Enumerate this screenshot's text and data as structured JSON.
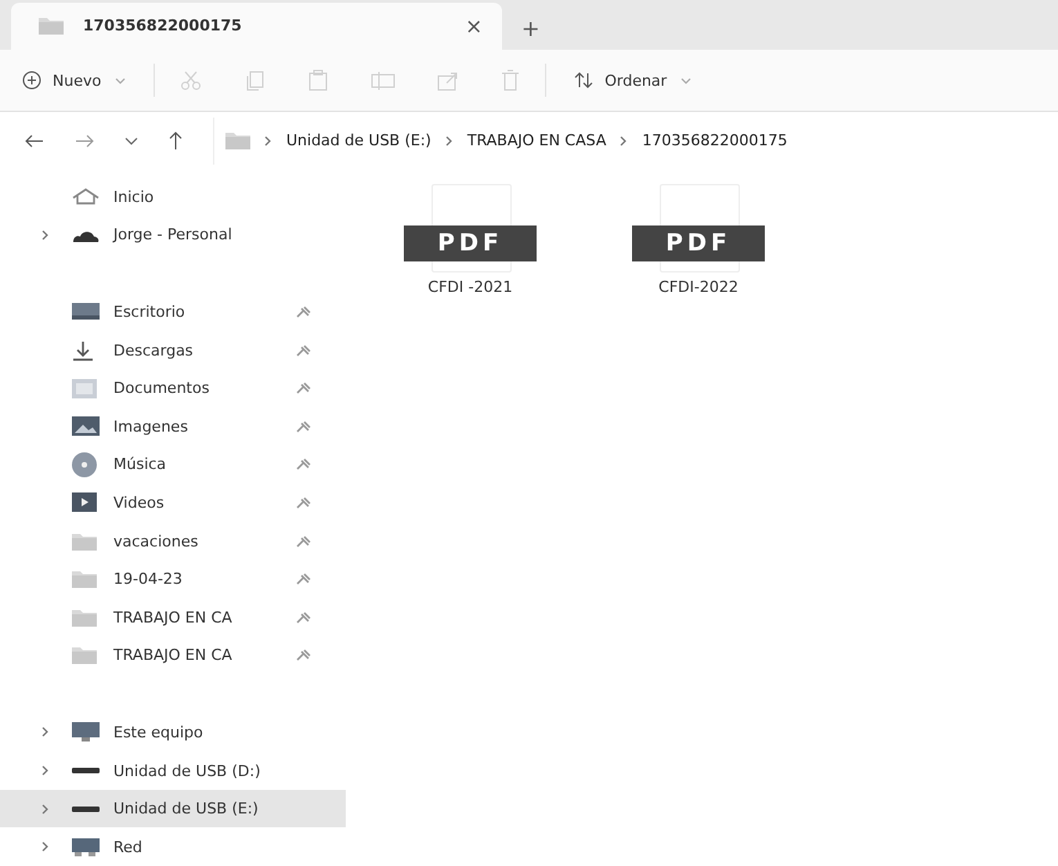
{
  "tab": {
    "title": "170356822000175",
    "close": "×",
    "new_tab": "+"
  },
  "toolbar": {
    "new_label": "Nuevo",
    "sort_label": "Ordenar",
    "actions": [
      {
        "kind": "cut",
        "disabled": true
      },
      {
        "kind": "copy",
        "disabled": true
      },
      {
        "kind": "paste",
        "disabled": true
      },
      {
        "kind": "rename",
        "disabled": true
      },
      {
        "kind": "share",
        "disabled": true
      },
      {
        "kind": "delete",
        "disabled": true
      }
    ]
  },
  "breadcrumb": [
    "Unidad de USB (E:)",
    "TRABAJO EN CASA",
    "170356822000175"
  ],
  "sidebar": {
    "groups": [
      [
        {
          "label": "Inicio",
          "kind": "home",
          "expandable": false,
          "pinned": false,
          "selected": false
        },
        {
          "label": "Jorge - Personal",
          "kind": "cloud",
          "expandable": true,
          "pinned": false,
          "selected": false
        }
      ],
      [
        {
          "label": "Escritorio",
          "kind": "desktop",
          "expandable": false,
          "pinned": true,
          "selected": false
        },
        {
          "label": "Descargas",
          "kind": "download",
          "expandable": false,
          "pinned": true,
          "selected": false
        },
        {
          "label": "Documentos",
          "kind": "document",
          "expandable": false,
          "pinned": true,
          "selected": false
        },
        {
          "label": "Imagenes",
          "kind": "picture",
          "expandable": false,
          "pinned": true,
          "selected": false
        },
        {
          "label": "Música",
          "kind": "music",
          "expandable": false,
          "pinned": true,
          "selected": false
        },
        {
          "label": "Videos",
          "kind": "video",
          "expandable": false,
          "pinned": true,
          "selected": false
        },
        {
          "label": "vacaciones",
          "kind": "folder",
          "expandable": false,
          "pinned": true,
          "selected": false
        },
        {
          "label": "19-04-23",
          "kind": "folder",
          "expandable": false,
          "pinned": true,
          "selected": false
        },
        {
          "label": "TRABAJO EN CA",
          "kind": "folder",
          "expandable": false,
          "pinned": true,
          "selected": false
        },
        {
          "label": "TRABAJO EN CA",
          "kind": "folder",
          "expandable": false,
          "pinned": true,
          "selected": false
        }
      ],
      [
        {
          "label": "Este equipo",
          "kind": "pc",
          "expandable": true,
          "pinned": false,
          "selected": false
        },
        {
          "label": "Unidad de USB (D:)",
          "kind": "drive",
          "expandable": true,
          "pinned": false,
          "selected": false
        },
        {
          "label": "Unidad de USB (E:)",
          "kind": "drive",
          "expandable": true,
          "pinned": false,
          "selected": true
        },
        {
          "label": "Red",
          "kind": "network",
          "expandable": true,
          "pinned": false,
          "selected": false
        }
      ]
    ]
  },
  "files": [
    {
      "name": "CFDI -2021",
      "badge": "PDF"
    },
    {
      "name": "CFDI-2022",
      "badge": "PDF"
    }
  ]
}
